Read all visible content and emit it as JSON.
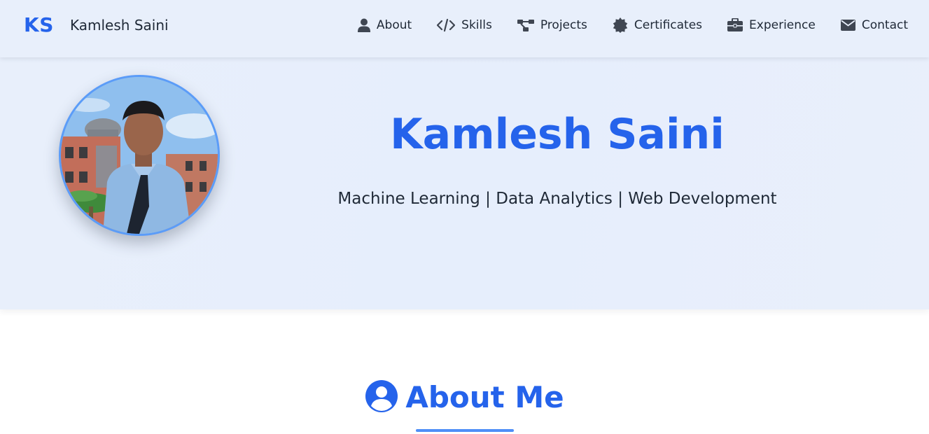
{
  "brand": {
    "logo": "KS",
    "name": "Kamlesh Saini"
  },
  "nav": {
    "items": [
      {
        "label": "About",
        "icon": "user-icon"
      },
      {
        "label": "Skills",
        "icon": "code-icon"
      },
      {
        "label": "Projects",
        "icon": "project-diagram-icon"
      },
      {
        "label": "Certificates",
        "icon": "certificate-icon"
      },
      {
        "label": "Experience",
        "icon": "briefcase-icon"
      },
      {
        "label": "Contact",
        "icon": "envelope-icon"
      }
    ]
  },
  "hero": {
    "name": "Kamlesh Saini",
    "tagline": "Machine Learning | Data Analytics | Web Development",
    "avatar_icon": "profile-photo"
  },
  "about": {
    "title": "About Me",
    "icon": "user-circle-icon"
  },
  "colors": {
    "accent": "#2563eb",
    "navbar_bg": "#e8effb",
    "hero_bg": "#e6eefc",
    "text": "#1f2937",
    "underline": "#4f8ff7"
  }
}
